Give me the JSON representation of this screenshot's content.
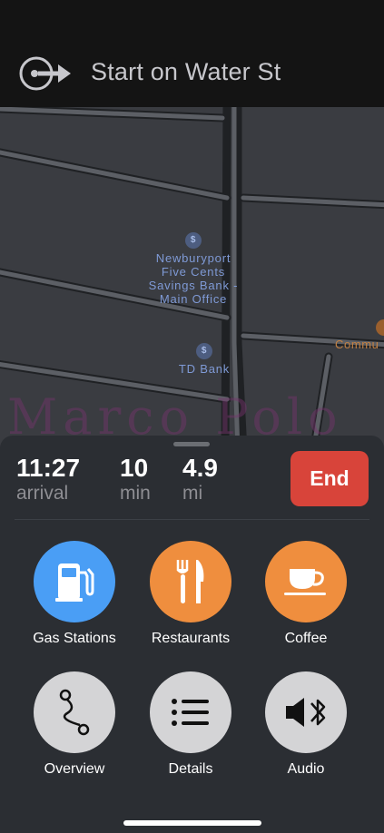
{
  "navigation": {
    "instruction": "Start on Water St",
    "turn_icon": "start-route-icon"
  },
  "map": {
    "pois": [
      {
        "name": "Newburyport\nFive Cents\nSavings Bank -\nMain Office",
        "icon": "bank-icon"
      },
      {
        "name": "TD Bank",
        "icon": "bank-icon"
      },
      {
        "name": "Commu",
        "icon": "poi-icon"
      }
    ],
    "watermark": "Marco Polo"
  },
  "trip": {
    "arrival_time": "11:27",
    "arrival_label": "arrival",
    "duration_value": "10",
    "duration_unit": "min",
    "distance_value": "4.9",
    "distance_unit": "mi",
    "end_label": "End"
  },
  "actions": [
    {
      "label": "Gas Stations",
      "icon": "gas-pump-icon",
      "color": "#4a9ef5"
    },
    {
      "label": "Restaurants",
      "icon": "fork-knife-icon",
      "color": "#ef8e3e"
    },
    {
      "label": "Coffee",
      "icon": "coffee-cup-icon",
      "color": "#ef8e3e"
    },
    {
      "label": "Overview",
      "icon": "route-overview-icon",
      "color": "#d4d4d6"
    },
    {
      "label": "Details",
      "icon": "list-icon",
      "color": "#d4d4d6"
    },
    {
      "label": "Audio",
      "icon": "speaker-bluetooth-icon",
      "color": "#d4d4d6"
    }
  ],
  "colors": {
    "end_button": "#d8443a",
    "sheet_background": "#2b2e33",
    "map_background": "#3a3c41"
  }
}
